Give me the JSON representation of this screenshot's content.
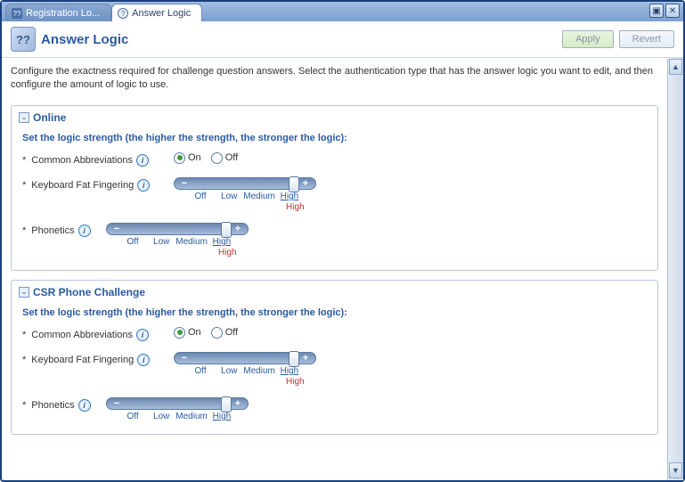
{
  "tabs": {
    "inactive": "Registration Lo...",
    "active": "Answer Logic"
  },
  "header": {
    "title": "Answer Logic",
    "apply": "Apply",
    "revert": "Revert"
  },
  "description": "Configure the exactness required for challenge question answers. Select the authentication type that has the answer logic you want to edit, and then configure the amount of logic to use.",
  "strength_label": "Set the logic strength (the higher the strength, the stronger the logic):",
  "slider": {
    "ticks": {
      "off": "Off",
      "low": "Low",
      "medium": "Medium",
      "high": "High"
    }
  },
  "radio": {
    "on": "On",
    "off": "Off"
  },
  "fields": {
    "abbrev": "Common Abbreviations",
    "fatfinger": "Keyboard Fat Fingering",
    "phonetics": "Phonetics"
  },
  "sections": {
    "online": {
      "title": "Online",
      "abbrev_value": "On",
      "fatfinger_value": "High",
      "phonetics_value": "High"
    },
    "csr": {
      "title": "CSR Phone Challenge",
      "abbrev_value": "On",
      "fatfinger_value": "High",
      "phonetics_value": "High"
    }
  }
}
